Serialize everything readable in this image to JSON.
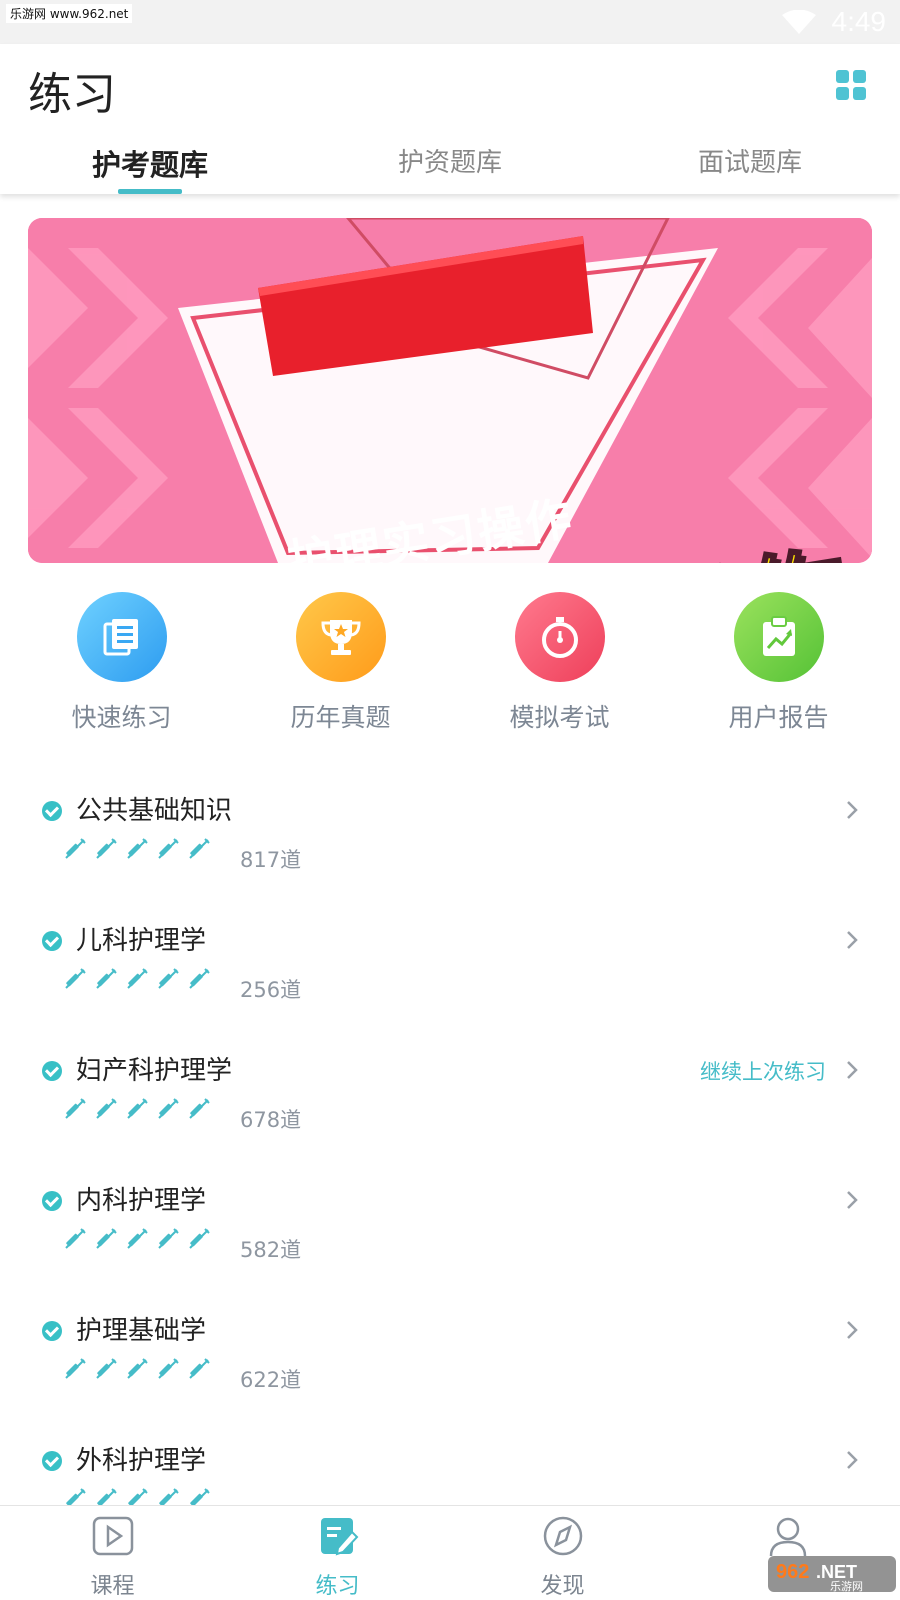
{
  "status_bar": {
    "watermark": "乐游网 www.962.net",
    "time": "4:49"
  },
  "header": {
    "title": "练习"
  },
  "tabs": [
    {
      "label": "护考题库",
      "active": true
    },
    {
      "label": "护资题库",
      "active": false
    },
    {
      "label": "面试题库",
      "active": false
    }
  ],
  "banner": {
    "badge": "护理实习操作",
    "headline": "口腔护理操作"
  },
  "actions": [
    {
      "label": "快速练习",
      "icon": "book-icon",
      "color": "#2d9cf0"
    },
    {
      "label": "历年真题",
      "icon": "trophy-icon",
      "color": "#ff9b1a"
    },
    {
      "label": "模拟考试",
      "icon": "stopwatch-icon",
      "color": "#ee3f5a"
    },
    {
      "label": "用户报告",
      "icon": "report-chart-icon",
      "color": "#55c236"
    }
  ],
  "subjects": [
    {
      "name": "公共基础知识",
      "count": "817道",
      "continue": ""
    },
    {
      "name": "儿科护理学",
      "count": "256道",
      "continue": ""
    },
    {
      "name": "妇产科护理学",
      "count": "678道",
      "continue": "继续上次练习"
    },
    {
      "name": "内科护理学",
      "count": "582道",
      "continue": ""
    },
    {
      "name": "护理基础学",
      "count": "622道",
      "continue": ""
    },
    {
      "name": "外科护理学",
      "count": "",
      "continue": ""
    }
  ],
  "bottom_nav": [
    {
      "label": "课程",
      "icon": "play-icon",
      "active": false
    },
    {
      "label": "练习",
      "icon": "practice-edit-icon",
      "active": true
    },
    {
      "label": "发现",
      "icon": "compass-icon",
      "active": false
    },
    {
      "label": "",
      "icon": "profile-icon",
      "active": false
    }
  ],
  "watermark_br": "962.NET 乐游网",
  "colors": {
    "accent": "#45bcc8",
    "banner_pink": "#f77eaa"
  }
}
